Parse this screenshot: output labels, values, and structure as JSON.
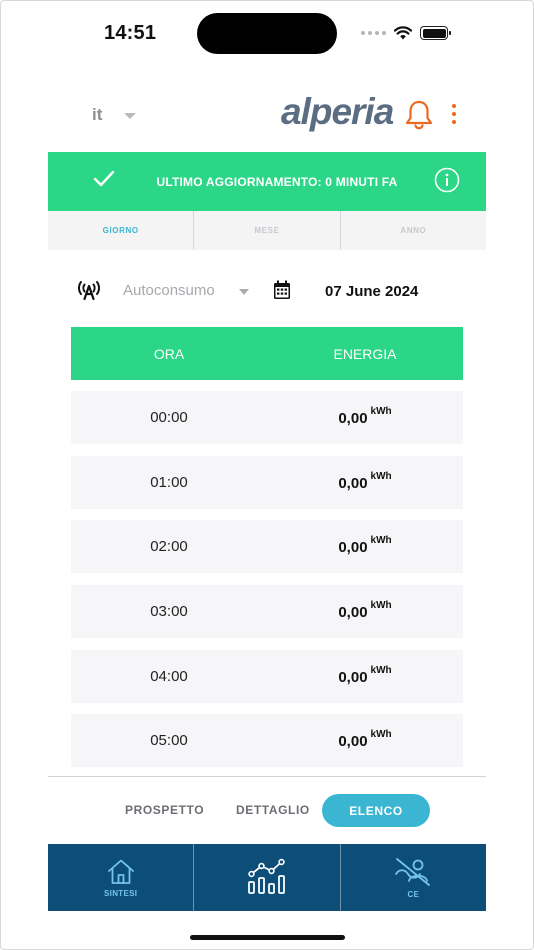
{
  "status_bar": {
    "time": "14:51"
  },
  "header": {
    "language": "it",
    "logo_text": "alperia"
  },
  "banner": {
    "text": "ULTIMO AGGIORNAMENTO: 0 MINUTI FA"
  },
  "period_tabs": [
    {
      "label": "GIORNO",
      "active": true
    },
    {
      "label": "MESE",
      "active": false
    },
    {
      "label": "ANNO",
      "active": false
    }
  ],
  "filters": {
    "mode": "Autoconsumo",
    "date": "07 June 2024"
  },
  "table": {
    "headers": [
      "ORA",
      "ENERGIA"
    ],
    "unit": "kWh",
    "rows": [
      {
        "hour": "00:00",
        "value": "0,00"
      },
      {
        "hour": "01:00",
        "value": "0,00"
      },
      {
        "hour": "02:00",
        "value": "0,00"
      },
      {
        "hour": "03:00",
        "value": "0,00"
      },
      {
        "hour": "04:00",
        "value": "0,00"
      },
      {
        "hour": "05:00",
        "value": "0,00"
      }
    ]
  },
  "view_tabs": [
    {
      "label": "PROSPETTO",
      "active": false
    },
    {
      "label": "DETTAGLIO",
      "active": false
    },
    {
      "label": "ELENCO",
      "active": true
    }
  ],
  "bottom_nav": [
    {
      "label": "SINTESI",
      "icon": "home-icon"
    },
    {
      "label": "",
      "icon": "chart-icon"
    },
    {
      "label": "CE",
      "icon": "community-energy-icon"
    }
  ],
  "colors": {
    "green": "#2bd687",
    "accent_blue": "#3ab6d3",
    "nav_bg": "#0d4e78",
    "bell_orange": "#e86b21",
    "logo_slate": "#5a6d82"
  }
}
